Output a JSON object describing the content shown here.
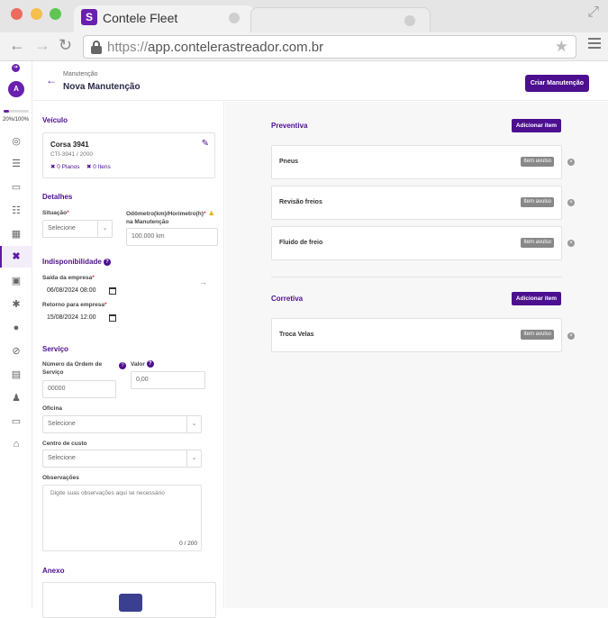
{
  "browser": {
    "tab_title": "Contele Fleet",
    "tab_logo": "S",
    "url_protocol": "https://",
    "url_host": "app.contelerastreador.com.br"
  },
  "sidebar": {
    "avatar_letter": "A",
    "progress_text": "20%/100%",
    "progress_fraction": 0.2,
    "icons": [
      "arrow-right-icon",
      "globe-icon",
      "list-icon",
      "car-icon",
      "checklist-icon",
      "grid-icon",
      "tools-icon",
      "book-icon",
      "sparkle-icon",
      "tire-icon",
      "block-icon",
      "id-card-icon",
      "user-icon",
      "car-icon",
      "map-icon"
    ]
  },
  "header": {
    "breadcrumb": "Manutenção",
    "title": "Nova Manutenção",
    "create_button": "Criar Manutenção"
  },
  "vehicle": {
    "section": "Veículo",
    "name": "Corsa 3941",
    "plate_year": "CTI-3941 / 2000",
    "plans": "0 Planos",
    "items": "0 Itens"
  },
  "details": {
    "section": "Detalhes",
    "situation_label": "Situação",
    "situation_placeholder": "Selecione",
    "odometer_label": "Odômetro(km)/Horímetro(h)",
    "odometer_label2": "na Manutenção",
    "odometer_value": "100.000 km"
  },
  "unavailability": {
    "section": "Indisponibilidade",
    "exit_label": "Saída da empresa",
    "exit_value": "06/08/2024 08:00",
    "return_label": "Retorno para empresa",
    "return_value": "15/08/2024 12:00"
  },
  "service": {
    "section": "Serviço",
    "order_label": "Número da Ordem de",
    "order_label2": "Serviço",
    "order_value": "00000",
    "value_label": "Valor",
    "value_value": "0,00",
    "workshop_label": "Oficina",
    "workshop_placeholder": "Selecione",
    "cost_center_label": "Centro de custo",
    "cost_center_placeholder": "Selecione",
    "notes_label": "Observações",
    "notes_placeholder": "Digite suas observações aqui se necessário",
    "notes_counter": "0 / 200",
    "attachment_section": "Anexo"
  },
  "preventive": {
    "section": "Preventiva",
    "add_button": "Adicionar item",
    "items": [
      {
        "name": "Pneus",
        "badge": "Item avulso"
      },
      {
        "name": "Revisão freios",
        "badge": "Item avulso"
      },
      {
        "name": "Fluido de freio",
        "badge": "Item avulso"
      }
    ]
  },
  "corrective": {
    "section": "Corretiva",
    "add_button": "Adicionar item",
    "items": [
      {
        "name": "Troca Velas",
        "badge": "Item avulso"
      }
    ]
  }
}
